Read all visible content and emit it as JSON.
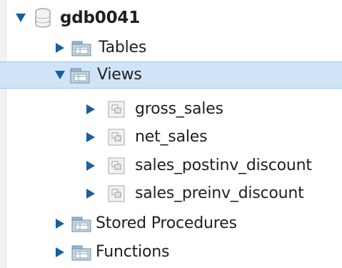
{
  "tree": {
    "schema": {
      "label": "gdb0041",
      "expanded": true,
      "icon": "database-icon"
    },
    "tables": {
      "label": "Tables",
      "expanded": false,
      "icon": "folder-icon"
    },
    "views": {
      "label": "Views",
      "expanded": true,
      "selected": true,
      "icon": "folder-icon",
      "items": [
        {
          "label": "gross_sales",
          "icon": "view-icon"
        },
        {
          "label": "net_sales",
          "icon": "view-icon"
        },
        {
          "label": "sales_postinv_discount",
          "icon": "view-icon"
        },
        {
          "label": "sales_preinv_discount",
          "icon": "view-icon"
        }
      ]
    },
    "stored_procedures": {
      "label": "Stored Procedures",
      "expanded": false,
      "icon": "folder-icon"
    },
    "functions": {
      "label": "Functions",
      "expanded": false,
      "icon": "folder-icon"
    }
  },
  "colors": {
    "selection_bg": "#cfe5f7",
    "selection_border": "#99c9ef",
    "arrow": "#1a5f9a",
    "text": "#1f1f1f"
  }
}
